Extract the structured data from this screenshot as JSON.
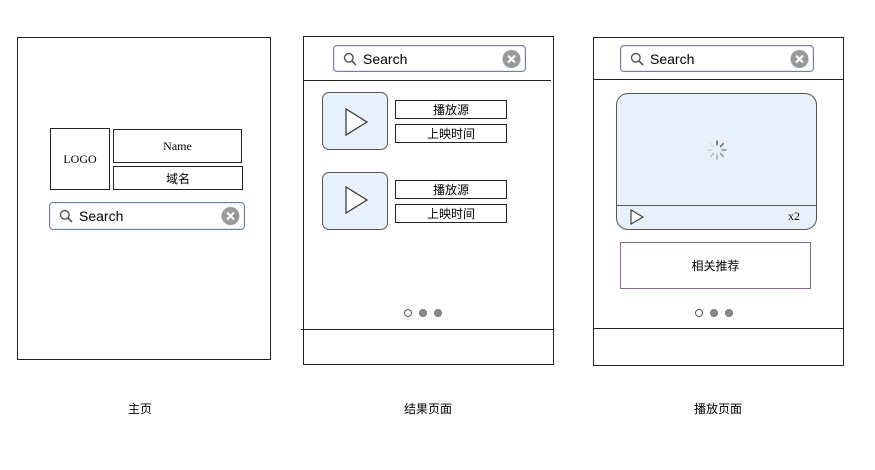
{
  "screen_home": {
    "logo": "LOGO",
    "name_label": "Name",
    "domain_label": "域名",
    "search_text": "Search",
    "caption": "主页"
  },
  "screen_results": {
    "search_text": "Search",
    "items": [
      {
        "source_label": "播放源",
        "time_label": "上映时间"
      },
      {
        "source_label": "播放源",
        "time_label": "上映时间"
      }
    ],
    "caption": "结果页面"
  },
  "screen_player": {
    "search_text": "Search",
    "speed_label": "x2",
    "related_label": "相关推荐",
    "caption": "播放页面"
  },
  "icons": {
    "search": "search-icon",
    "clear": "clear-icon",
    "play": "play-icon",
    "loading": "loading-spinner-icon"
  },
  "colors": {
    "thumbnail_fill": "#e8f1fb",
    "search_border": "#6b7fa6",
    "clear_icon": "#999999",
    "related_border": "#8a6a8a"
  }
}
